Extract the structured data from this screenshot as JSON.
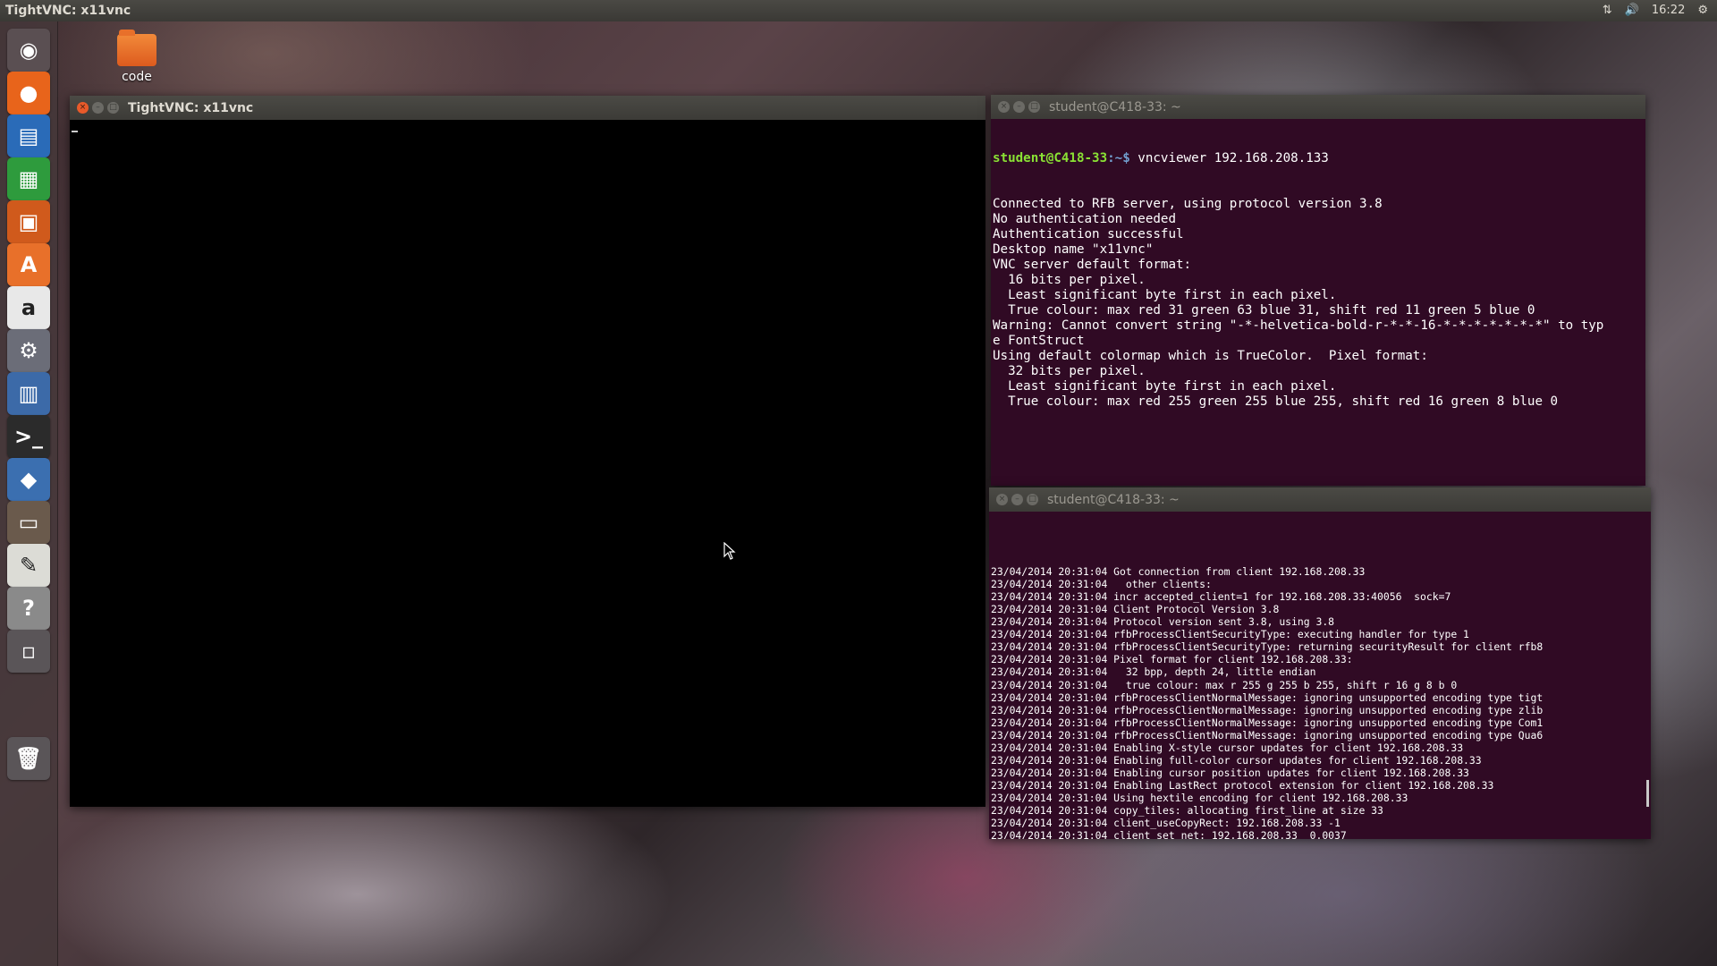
{
  "top_panel": {
    "title": "TightVNC: x11vnc",
    "clock": "16:22",
    "icons": [
      "network-icon",
      "volume-icon",
      "gear-icon"
    ]
  },
  "launcher": {
    "items": [
      {
        "name": "ubuntu-dash",
        "glyph": "◉",
        "color": "#5a4f52"
      },
      {
        "name": "firefox",
        "glyph": "●",
        "color": "#e8641b"
      },
      {
        "name": "libreoffice-writer",
        "glyph": "▤",
        "color": "#2a6bb8"
      },
      {
        "name": "libreoffice-calc",
        "glyph": "▦",
        "color": "#2e9b3d"
      },
      {
        "name": "libreoffice-impress",
        "glyph": "▣",
        "color": "#d05a1c"
      },
      {
        "name": "ubuntu-software-center",
        "glyph": "A",
        "color": "#e8702a"
      },
      {
        "name": "amazon",
        "glyph": "a",
        "color": "#e8e8e8"
      },
      {
        "name": "system-settings",
        "glyph": "⚙",
        "color": "#6b6d78"
      },
      {
        "name": "remote-desktop",
        "glyph": "▥",
        "color": "#3c6aa8"
      },
      {
        "name": "terminal",
        "glyph": ">_",
        "color": "#2b2b2b"
      },
      {
        "name": "python",
        "glyph": "◆",
        "color": "#3b6fb0"
      },
      {
        "name": "files",
        "glyph": "▭",
        "color": "#6a5a4c"
      },
      {
        "name": "text-editor",
        "glyph": "✎",
        "color": "#dcdcd6"
      },
      {
        "name": "help",
        "glyph": "?",
        "color": "#8a8a8a"
      },
      {
        "name": "workspaces",
        "glyph": "▫",
        "color": "#5a5558"
      },
      {
        "name": "trash",
        "glyph": "🗑",
        "color": "#5a5558"
      }
    ]
  },
  "desktop": {
    "icon_label": "code"
  },
  "vnc_window": {
    "title": "TightVNC: x11vnc"
  },
  "terminal_top": {
    "title": "student@C418-33: ~",
    "prompt_user": "student@C418-33",
    "prompt_path": ":~$",
    "command": " vncviewer 192.168.208.133",
    "lines": [
      "Connected to RFB server, using protocol version 3.8",
      "No authentication needed",
      "Authentication successful",
      "Desktop name \"x11vnc\"",
      "VNC server default format:",
      "  16 bits per pixel.",
      "  Least significant byte first in each pixel.",
      "  True colour: max red 31 green 63 blue 31, shift red 11 green 5 blue 0",
      "Warning: Cannot convert string \"-*-helvetica-bold-r-*-*-16-*-*-*-*-*-*-*\" to typ",
      "e FontStruct",
      "Using default colormap which is TrueColor.  Pixel format:",
      "  32 bits per pixel.",
      "  Least significant byte first in each pixel.",
      "  True colour: max red 255 green 255 blue 255, shift red 16 green 8 blue 0"
    ]
  },
  "terminal_bottom": {
    "title": "student@C418-33: ~",
    "lines": [
      "23/04/2014 20:31:04 Got connection from client 192.168.208.33",
      "23/04/2014 20:31:04   other clients:",
      "23/04/2014 20:31:04 incr accepted_client=1 for 192.168.208.33:40056  sock=7",
      "23/04/2014 20:31:04 Client Protocol Version 3.8",
      "23/04/2014 20:31:04 Protocol version sent 3.8, using 3.8",
      "23/04/2014 20:31:04 rfbProcessClientSecurityType: executing handler for type 1",
      "23/04/2014 20:31:04 rfbProcessClientSecurityType: returning securityResult for client rfb8",
      "23/04/2014 20:31:04 Pixel format for client 192.168.208.33:",
      "23/04/2014 20:31:04   32 bpp, depth 24, little endian",
      "23/04/2014 20:31:04   true colour: max r 255 g 255 b 255, shift r 16 g 8 b 0",
      "23/04/2014 20:31:04 rfbProcessClientNormalMessage: ignoring unsupported encoding type tigt",
      "23/04/2014 20:31:04 rfbProcessClientNormalMessage: ignoring unsupported encoding type zlib",
      "23/04/2014 20:31:04 rfbProcessClientNormalMessage: ignoring unsupported encoding type Com1",
      "23/04/2014 20:31:04 rfbProcessClientNormalMessage: ignoring unsupported encoding type Qua6",
      "23/04/2014 20:31:04 Enabling X-style cursor updates for client 192.168.208.33",
      "23/04/2014 20:31:04 Enabling full-color cursor updates for client 192.168.208.33",
      "23/04/2014 20:31:04 Enabling cursor position updates for client 192.168.208.33",
      "23/04/2014 20:31:04 Enabling LastRect protocol extension for client 192.168.208.33",
      "23/04/2014 20:31:04 Using hextile encoding for client 192.168.208.33",
      "23/04/2014 20:31:04 copy_tiles: allocating first_line at size 33",
      "23/04/2014 20:31:04 client_useCopyRect: 192.168.208.33 -1",
      "23/04/2014 20:31:04 client_set_net: 192.168.208.33  0.0037"
    ]
  }
}
